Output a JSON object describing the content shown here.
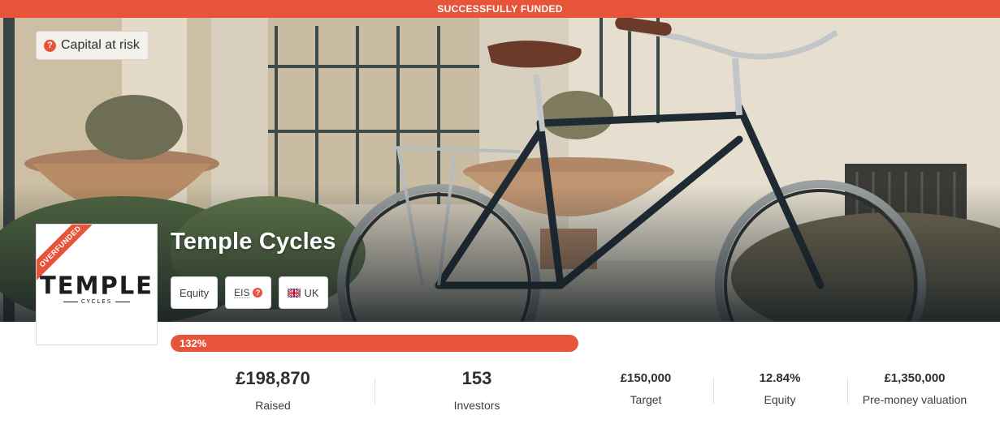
{
  "banner": {
    "status": "SUCCESSFULLY FUNDED"
  },
  "hero": {
    "capital_risk": "Capital at risk",
    "company_name": "Temple Cycles",
    "tags": {
      "equity": "Equity",
      "eis": "EIS",
      "country": "UK"
    }
  },
  "logo": {
    "ribbon": "OVERFUNDED",
    "word": "TEMPLE",
    "sub": "CYCLES"
  },
  "progress": {
    "label": "132%",
    "percent": 132
  },
  "stats": {
    "raised": {
      "value": "£198,870",
      "label": "Raised"
    },
    "investors": {
      "value": "153",
      "label": "Investors"
    },
    "target": {
      "value": "£150,000",
      "label": "Target"
    },
    "equity": {
      "value": "12.84%",
      "label": "Equity"
    },
    "valuation": {
      "value": "£1,350,000",
      "label": "Pre-money valuation"
    }
  },
  "colors": {
    "accent": "#e8543a",
    "text": "#2b2f33"
  },
  "icons": {
    "help": "question-circle-icon",
    "flag": "uk-flag-icon"
  }
}
